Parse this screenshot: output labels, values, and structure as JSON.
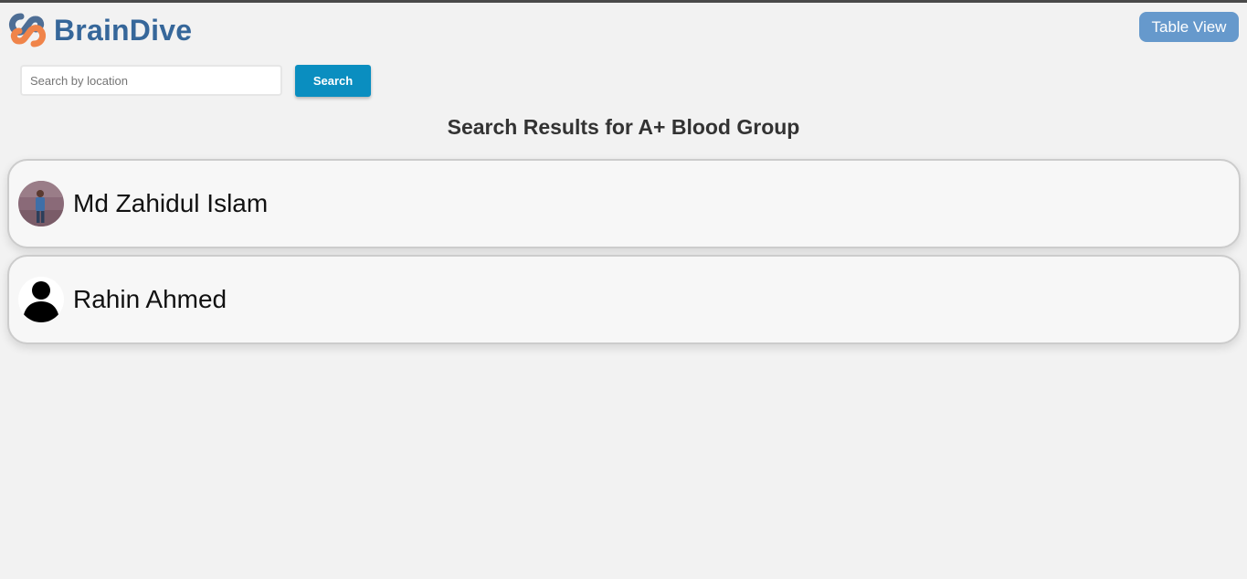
{
  "header": {
    "brand_name": "BrainDive",
    "table_view_label": "Table View"
  },
  "search": {
    "placeholder": "Search by location",
    "value": "",
    "button_label": "Search"
  },
  "results": {
    "title": "Search Results for A+ Blood Group",
    "donors": [
      {
        "name": "Md Zahidul Islam",
        "avatar": "photo-avatar"
      },
      {
        "name": "Rahin Ahmed",
        "avatar": "default-user-icon"
      }
    ]
  },
  "colors": {
    "brand_text": "#36679a",
    "table_view_button": "#6699cc",
    "search_button": "#0a8ec0",
    "background": "#f2f2f2"
  }
}
